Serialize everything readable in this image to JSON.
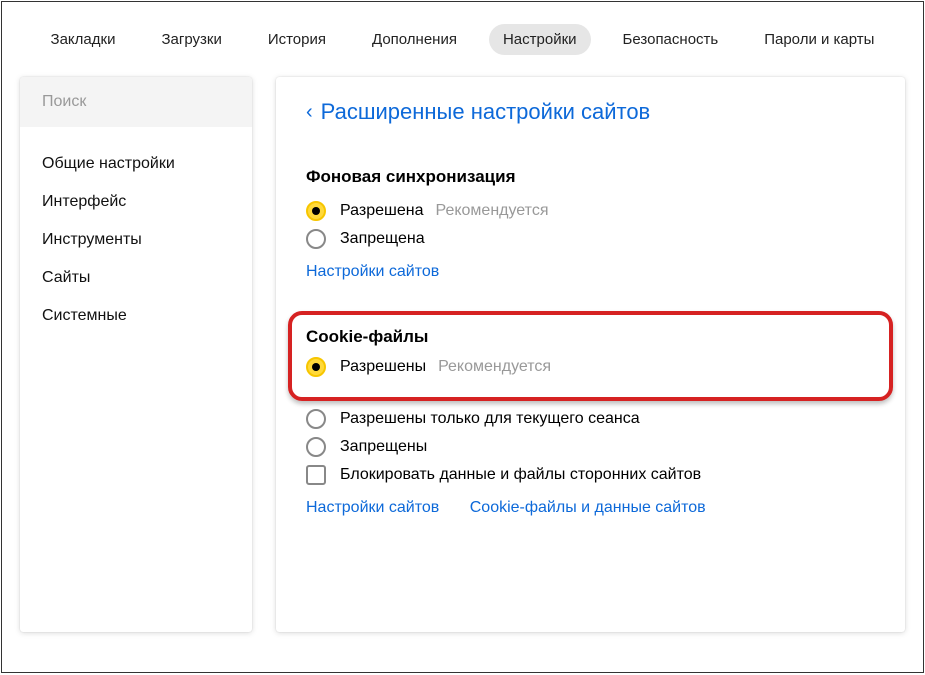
{
  "topnav": {
    "items": [
      "Закладки",
      "Загрузки",
      "История",
      "Дополнения",
      "Настройки",
      "Безопасность",
      "Пароли и карты"
    ],
    "active_index": 4
  },
  "sidebar": {
    "search_placeholder": "Поиск",
    "items": [
      "Общие настройки",
      "Интерфейс",
      "Инструменты",
      "Сайты",
      "Системные"
    ]
  },
  "main": {
    "back_chevron": "‹",
    "title": "Расширенные настройки сайтов",
    "sync_section": {
      "title": "Фоновая синхронизация",
      "options": [
        {
          "label": "Разрешена",
          "selected": true,
          "hint": "Рекомендуется"
        },
        {
          "label": "Запрещена",
          "selected": false
        }
      ],
      "link1": "Настройки сайтов"
    },
    "cookies_section": {
      "title": "Cookie-файлы",
      "highlight_option": {
        "label": "Разрешены",
        "selected": true,
        "hint": "Рекомендуется"
      },
      "options": [
        {
          "label": "Разрешены только для текущего сеанса",
          "selected": false
        },
        {
          "label": "Запрещены",
          "selected": false
        }
      ],
      "checkbox": {
        "label": "Блокировать данные и файлы сторонних сайтов",
        "checked": false
      },
      "link1": "Настройки сайтов",
      "link2": "Cookie-файлы и данные сайтов"
    }
  }
}
